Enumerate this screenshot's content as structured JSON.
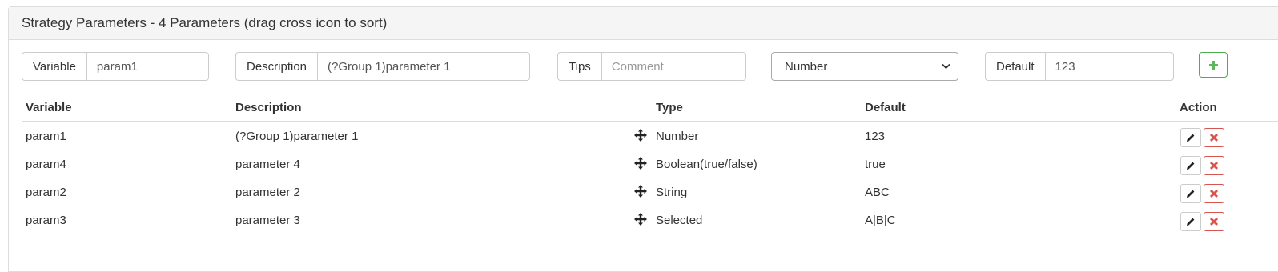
{
  "panel": {
    "title": "Strategy Parameters - 4 Parameters (drag cross icon to sort)"
  },
  "form": {
    "variable_label": "Variable",
    "variable_value": "param1",
    "description_label": "Description",
    "description_value": "(?Group 1)parameter 1",
    "tips_label": "Tips",
    "tips_placeholder": "Comment",
    "type_selected": "Number",
    "default_label": "Default",
    "default_value": "123",
    "add_icon": "plus-icon"
  },
  "table": {
    "headers": {
      "variable": "Variable",
      "description": "Description",
      "type": "Type",
      "default": "Default",
      "action": "Action"
    },
    "rows": [
      {
        "variable": "param1",
        "description": "(?Group 1)parameter 1",
        "type": "Number",
        "default": "123"
      },
      {
        "variable": "param4",
        "description": "parameter 4",
        "type": "Boolean(true/false)",
        "default": "true"
      },
      {
        "variable": "param2",
        "description": "parameter 2",
        "type": "String",
        "default": "ABC"
      },
      {
        "variable": "param3",
        "description": "parameter 3",
        "type": "Selected",
        "default": "A|B|C"
      }
    ],
    "row_icons": {
      "drag": "move-cross-icon",
      "edit": "pencil-icon",
      "delete": "x-icon"
    }
  },
  "colors": {
    "success": "#5cb85c",
    "danger": "#d9534f",
    "heading_bg": "#f5f5f5",
    "border": "#dddddd"
  }
}
